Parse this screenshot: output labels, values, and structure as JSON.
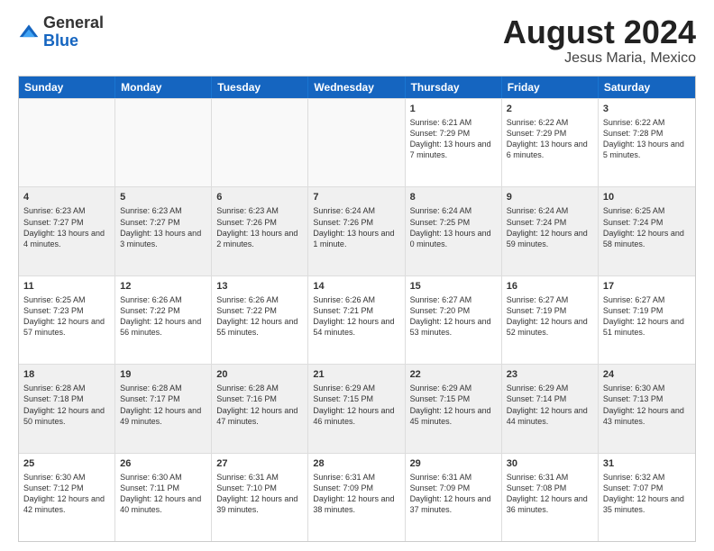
{
  "header": {
    "logo_general": "General",
    "logo_blue": "Blue",
    "main_title": "August 2024",
    "sub_title": "Jesus Maria, Mexico"
  },
  "days_of_week": [
    "Sunday",
    "Monday",
    "Tuesday",
    "Wednesday",
    "Thursday",
    "Friday",
    "Saturday"
  ],
  "weeks": [
    [
      {
        "day": "",
        "info": "",
        "empty": true
      },
      {
        "day": "",
        "info": "",
        "empty": true
      },
      {
        "day": "",
        "info": "",
        "empty": true
      },
      {
        "day": "",
        "info": "",
        "empty": true
      },
      {
        "day": "1",
        "info": "Sunrise: 6:21 AM\nSunset: 7:29 PM\nDaylight: 13 hours and 7 minutes."
      },
      {
        "day": "2",
        "info": "Sunrise: 6:22 AM\nSunset: 7:29 PM\nDaylight: 13 hours and 6 minutes."
      },
      {
        "day": "3",
        "info": "Sunrise: 6:22 AM\nSunset: 7:28 PM\nDaylight: 13 hours and 5 minutes."
      }
    ],
    [
      {
        "day": "4",
        "info": "Sunrise: 6:23 AM\nSunset: 7:27 PM\nDaylight: 13 hours and 4 minutes.",
        "shaded": true
      },
      {
        "day": "5",
        "info": "Sunrise: 6:23 AM\nSunset: 7:27 PM\nDaylight: 13 hours and 3 minutes.",
        "shaded": true
      },
      {
        "day": "6",
        "info": "Sunrise: 6:23 AM\nSunset: 7:26 PM\nDaylight: 13 hours and 2 minutes.",
        "shaded": true
      },
      {
        "day": "7",
        "info": "Sunrise: 6:24 AM\nSunset: 7:26 PM\nDaylight: 13 hours and 1 minute.",
        "shaded": true
      },
      {
        "day": "8",
        "info": "Sunrise: 6:24 AM\nSunset: 7:25 PM\nDaylight: 13 hours and 0 minutes.",
        "shaded": true
      },
      {
        "day": "9",
        "info": "Sunrise: 6:24 AM\nSunset: 7:24 PM\nDaylight: 12 hours and 59 minutes.",
        "shaded": true
      },
      {
        "day": "10",
        "info": "Sunrise: 6:25 AM\nSunset: 7:24 PM\nDaylight: 12 hours and 58 minutes.",
        "shaded": true
      }
    ],
    [
      {
        "day": "11",
        "info": "Sunrise: 6:25 AM\nSunset: 7:23 PM\nDaylight: 12 hours and 57 minutes."
      },
      {
        "day": "12",
        "info": "Sunrise: 6:26 AM\nSunset: 7:22 PM\nDaylight: 12 hours and 56 minutes."
      },
      {
        "day": "13",
        "info": "Sunrise: 6:26 AM\nSunset: 7:22 PM\nDaylight: 12 hours and 55 minutes."
      },
      {
        "day": "14",
        "info": "Sunrise: 6:26 AM\nSunset: 7:21 PM\nDaylight: 12 hours and 54 minutes."
      },
      {
        "day": "15",
        "info": "Sunrise: 6:27 AM\nSunset: 7:20 PM\nDaylight: 12 hours and 53 minutes."
      },
      {
        "day": "16",
        "info": "Sunrise: 6:27 AM\nSunset: 7:19 PM\nDaylight: 12 hours and 52 minutes."
      },
      {
        "day": "17",
        "info": "Sunrise: 6:27 AM\nSunset: 7:19 PM\nDaylight: 12 hours and 51 minutes."
      }
    ],
    [
      {
        "day": "18",
        "info": "Sunrise: 6:28 AM\nSunset: 7:18 PM\nDaylight: 12 hours and 50 minutes.",
        "shaded": true
      },
      {
        "day": "19",
        "info": "Sunrise: 6:28 AM\nSunset: 7:17 PM\nDaylight: 12 hours and 49 minutes.",
        "shaded": true
      },
      {
        "day": "20",
        "info": "Sunrise: 6:28 AM\nSunset: 7:16 PM\nDaylight: 12 hours and 47 minutes.",
        "shaded": true
      },
      {
        "day": "21",
        "info": "Sunrise: 6:29 AM\nSunset: 7:15 PM\nDaylight: 12 hours and 46 minutes.",
        "shaded": true
      },
      {
        "day": "22",
        "info": "Sunrise: 6:29 AM\nSunset: 7:15 PM\nDaylight: 12 hours and 45 minutes.",
        "shaded": true
      },
      {
        "day": "23",
        "info": "Sunrise: 6:29 AM\nSunset: 7:14 PM\nDaylight: 12 hours and 44 minutes.",
        "shaded": true
      },
      {
        "day": "24",
        "info": "Sunrise: 6:30 AM\nSunset: 7:13 PM\nDaylight: 12 hours and 43 minutes.",
        "shaded": true
      }
    ],
    [
      {
        "day": "25",
        "info": "Sunrise: 6:30 AM\nSunset: 7:12 PM\nDaylight: 12 hours and 42 minutes."
      },
      {
        "day": "26",
        "info": "Sunrise: 6:30 AM\nSunset: 7:11 PM\nDaylight: 12 hours and 40 minutes."
      },
      {
        "day": "27",
        "info": "Sunrise: 6:31 AM\nSunset: 7:10 PM\nDaylight: 12 hours and 39 minutes."
      },
      {
        "day": "28",
        "info": "Sunrise: 6:31 AM\nSunset: 7:09 PM\nDaylight: 12 hours and 38 minutes."
      },
      {
        "day": "29",
        "info": "Sunrise: 6:31 AM\nSunset: 7:09 PM\nDaylight: 12 hours and 37 minutes."
      },
      {
        "day": "30",
        "info": "Sunrise: 6:31 AM\nSunset: 7:08 PM\nDaylight: 12 hours and 36 minutes."
      },
      {
        "day": "31",
        "info": "Sunrise: 6:32 AM\nSunset: 7:07 PM\nDaylight: 12 hours and 35 minutes."
      }
    ]
  ]
}
